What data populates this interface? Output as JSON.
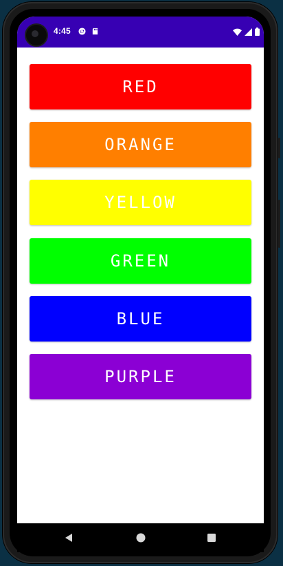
{
  "status_bar": {
    "time": "4:45",
    "background_color": "#3700b3",
    "notification_icons": [
      "sync-icon",
      "sd-card-icon"
    ],
    "system_icons": [
      "wifi-icon",
      "signal-icon",
      "battery-icon"
    ]
  },
  "buttons": [
    {
      "label": "RED",
      "color": "#ff0000"
    },
    {
      "label": "ORANGE",
      "color": "#ff7f00"
    },
    {
      "label": "YELLOW",
      "color": "#ffff00"
    },
    {
      "label": "GREEN",
      "color": "#00ff00"
    },
    {
      "label": "BLUE",
      "color": "#0000ff"
    },
    {
      "label": "PURPLE",
      "color": "#8b00d4"
    }
  ],
  "nav_bar": {
    "buttons": [
      "back-icon",
      "home-icon",
      "recents-icon"
    ]
  }
}
